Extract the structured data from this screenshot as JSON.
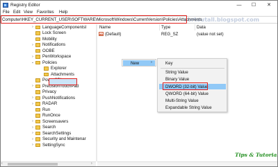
{
  "window": {
    "title": "Registry Editor",
    "controls": {
      "minimize": "—",
      "maximize": "☐",
      "close": "✕"
    }
  },
  "menubar": [
    "File",
    "Edit",
    "View",
    "Favorites",
    "Help"
  ],
  "address": {
    "path": "Computer\\HKEY_CURRENT_USER\\SOFTWARE\\Microsoft\\Windows\\CurrentVersion\\Policies\\Attachments",
    "watermark": "sortoutall.blogspot.com"
  },
  "tree": {
    "items": [
      {
        "label": "LanguageComponentsI",
        "expand": "›"
      },
      {
        "label": "Lock Screen",
        "expand": ""
      },
      {
        "label": "Mobility",
        "expand": ""
      },
      {
        "label": "Notifications",
        "expand": "›"
      },
      {
        "label": "OOBE",
        "expand": ""
      },
      {
        "label": "PenWorkspace",
        "expand": "›"
      },
      {
        "label": "Policies",
        "expand": "⌄"
      },
      {
        "label": "Explorer",
        "expand": ""
      },
      {
        "label": "Attachments",
        "expand": ""
      },
      {
        "label": "PowerCPL",
        "expand": ""
      },
      {
        "label": "PrecisionTouchPad",
        "expand": "›"
      },
      {
        "label": "Privacy",
        "expand": ""
      },
      {
        "label": "PushNotifications",
        "expand": "›"
      },
      {
        "label": "RADAR",
        "expand": "›"
      },
      {
        "label": "Run",
        "expand": ""
      },
      {
        "label": "RunOnce",
        "expand": ""
      },
      {
        "label": "Screensavers",
        "expand": "›"
      },
      {
        "label": "Search",
        "expand": "›"
      },
      {
        "label": "SearchSettings",
        "expand": "›"
      },
      {
        "label": "Security and Maintenar",
        "expand": "›"
      },
      {
        "label": "SettingSync",
        "expand": "›"
      }
    ],
    "selected": "Attachments"
  },
  "list": {
    "headers": {
      "name": "Name",
      "type": "Type",
      "data": "Data"
    },
    "rows": [
      {
        "icon": "ab",
        "name": "(Default)",
        "type": "REG_SZ",
        "data": "(value not set)"
      }
    ]
  },
  "context_menu": {
    "new_label": "New",
    "arrow": "›",
    "submenu": [
      "Key",
      "String Value",
      "Binary Value",
      "DWORD (32-bit) Value",
      "QWORD (64-bit) Value",
      "Multi-String Value",
      "Expandable String Value"
    ],
    "highlighted": "DWORD (32-bit) Value"
  },
  "scroll": {
    "left": "‹",
    "right": "›"
  },
  "brand": "Tips & Tutorial",
  "colors": {
    "highlight_border": "#e0211d",
    "menu_hover": "#91c9f7",
    "folder": "#f2c84b",
    "brand_green": "#2c8f2c"
  }
}
